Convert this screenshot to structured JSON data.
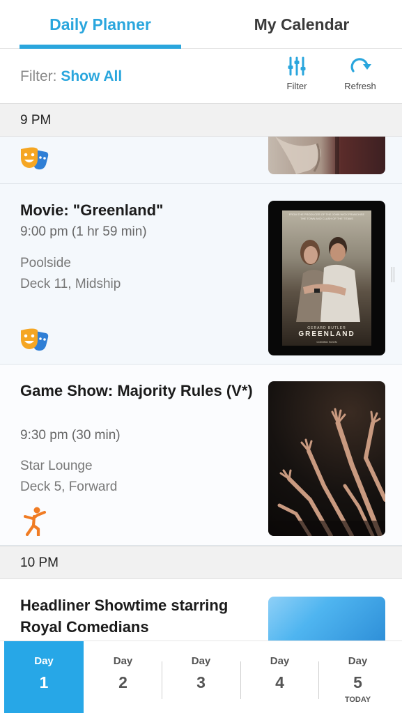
{
  "tabs": [
    {
      "label": "Daily Planner",
      "active": true
    },
    {
      "label": "My Calendar",
      "active": false
    }
  ],
  "filter": {
    "label": "Filter:",
    "value": "Show All",
    "filter_button": "Filter",
    "refresh_button": "Refresh"
  },
  "hours": [
    "9 PM",
    "10 PM"
  ],
  "events": [
    {
      "title": "Movie: \"Greenland\"",
      "time": "9:00 pm (1 hr 59 min)",
      "venue": "Poolside",
      "deck": "Deck 11, Midship",
      "category_icon": "theater-masks-icon",
      "poster": {
        "top_line_1": "FROM THE PRODUCER OF THE JOHN WICK FRANCHISE",
        "top_line_2": "THE TOWN AND CLASH OF THE TITANS",
        "actor": "GERARD BUTLER",
        "title": "GREENLAND",
        "tagline": "COMING SOON"
      }
    },
    {
      "title": "Game Show: Majority Rules (V*)",
      "time": "9:30 pm (30 min)",
      "venue": "Star Lounge",
      "deck": "Deck 5, Forward",
      "category_icon": "activity-person-icon"
    },
    {
      "title": "Headliner Showtime starring Royal Comedians"
    }
  ],
  "days": [
    {
      "word": "Day",
      "num": "1",
      "active": true
    },
    {
      "word": "Day",
      "num": "2"
    },
    {
      "word": "Day",
      "num": "3"
    },
    {
      "word": "Day",
      "num": "4"
    },
    {
      "word": "Day",
      "num": "5",
      "note": "TODAY"
    }
  ],
  "colors": {
    "accent": "#2aa6dd",
    "active_day": "#27a7e7",
    "theater_icon_orange": "#f5a623",
    "theater_icon_blue": "#2f7fd6",
    "activity_icon_orange": "#f07c24"
  }
}
